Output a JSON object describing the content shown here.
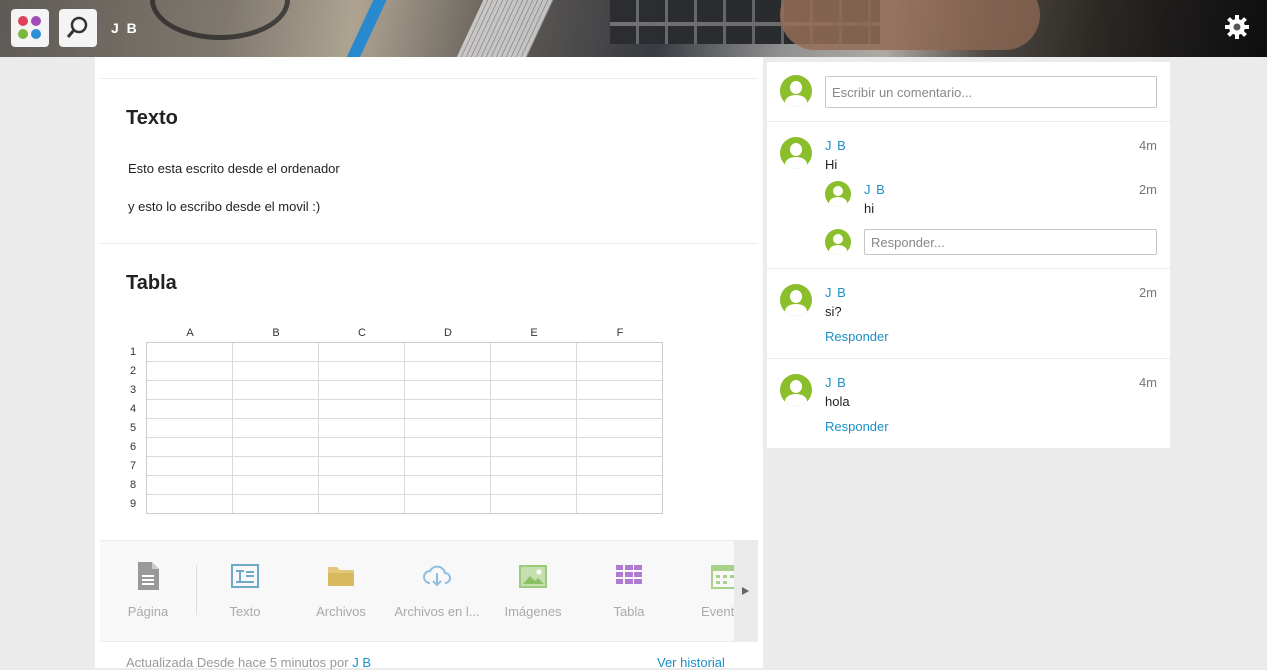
{
  "header": {
    "user_name": "J B"
  },
  "sections": [
    {
      "title": "Texto",
      "paragraphs": [
        "Esto esta escrito desde el ordenador",
        "y esto lo escribo desde el movil :)"
      ]
    },
    {
      "title": "Tabla",
      "columns": [
        "A",
        "B",
        "C",
        "D",
        "E",
        "F"
      ],
      "rows": [
        "1",
        "2",
        "3",
        "4",
        "5",
        "6",
        "7",
        "8",
        "9"
      ]
    }
  ],
  "blocks": [
    {
      "label": "Página",
      "icon": "page-icon"
    },
    {
      "label": "Texto",
      "icon": "text-icon"
    },
    {
      "label": "Archivos",
      "icon": "folder-icon"
    },
    {
      "label": "Archivos en l...",
      "icon": "cloud-download-icon"
    },
    {
      "label": "Imágenes",
      "icon": "image-icon"
    },
    {
      "label": "Tabla",
      "icon": "table-icon"
    },
    {
      "label": "Event",
      "icon": "calendar-icon"
    }
  ],
  "footer": {
    "updated_prefix": "Actualizada Desde hace 5 minutos por",
    "updated_by": "J B",
    "history_link": "Ver historial"
  },
  "comments": {
    "input_placeholder": "Escribir un comentario...",
    "threads": [
      {
        "author": "J B",
        "time": "4m",
        "text": "Hi",
        "reply": {
          "author": "J B",
          "time": "2m",
          "text": "hi"
        },
        "reply_placeholder": "Responder..."
      },
      {
        "author": "J B",
        "time": "2m",
        "text": "si?",
        "reply_label": "Responder"
      },
      {
        "author": "J B",
        "time": "4m",
        "text": "hola",
        "reply_label": "Responder"
      }
    ]
  },
  "colors": {
    "accent": "#1b8fc6",
    "avatar": "#8abe2a"
  }
}
